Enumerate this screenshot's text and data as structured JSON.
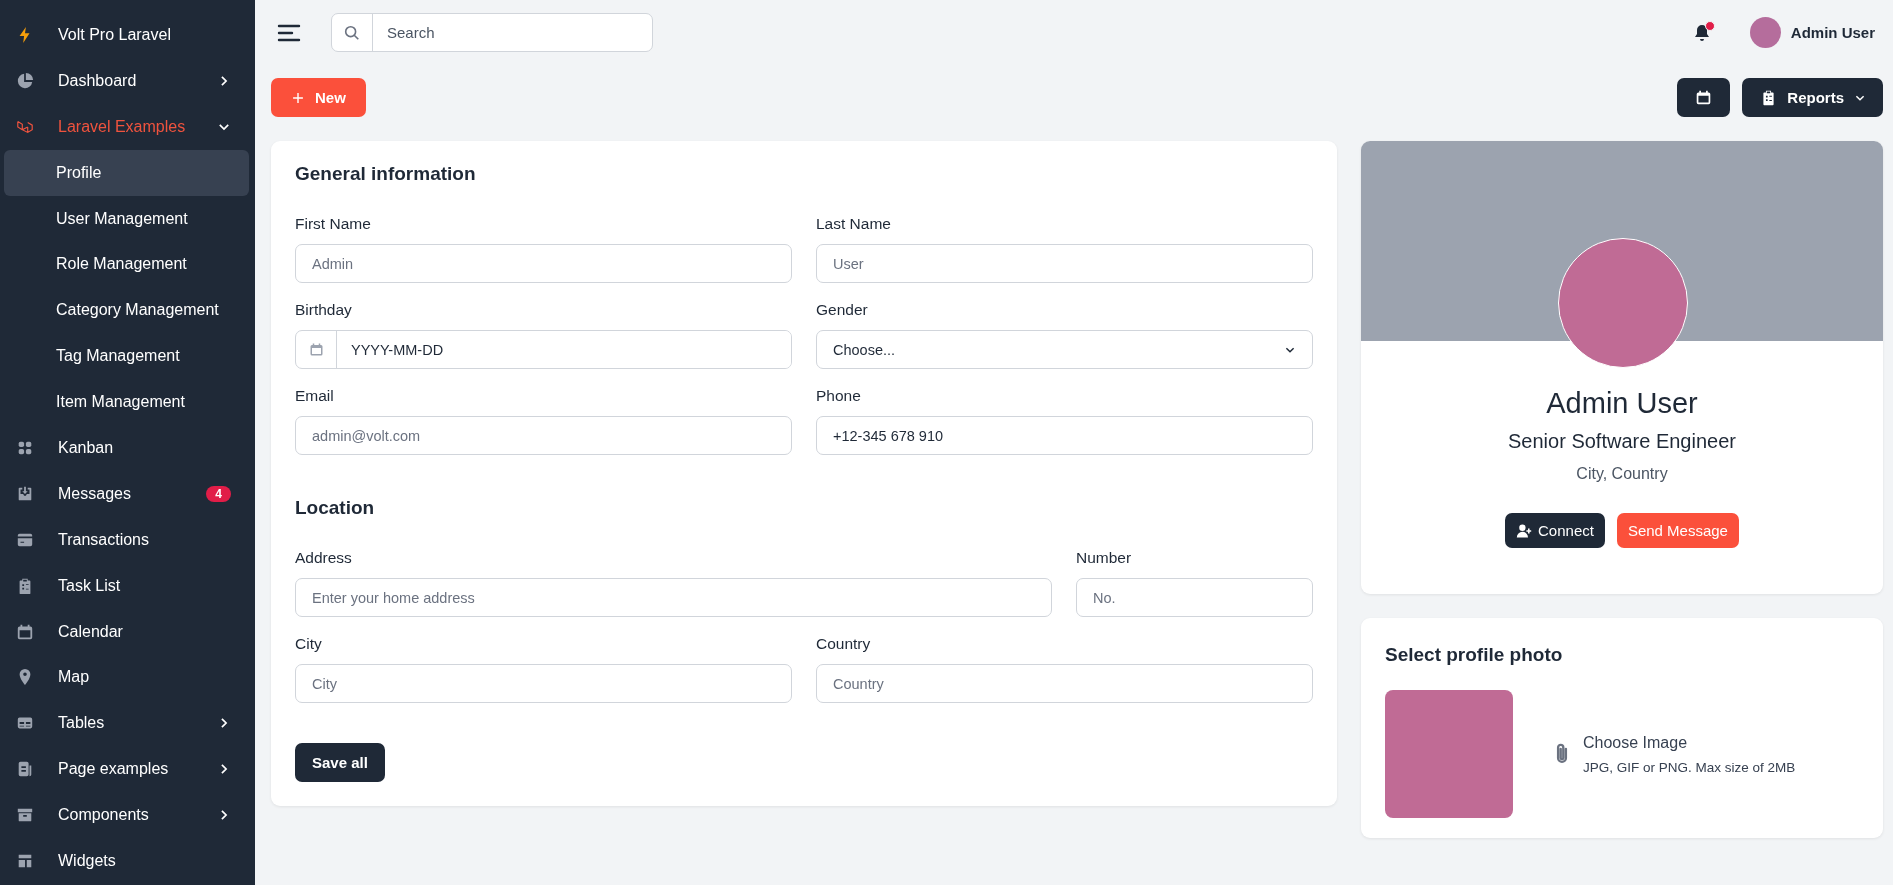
{
  "sidebar": {
    "brand": "Volt Pro Laravel",
    "items": [
      {
        "label": "Dashboard",
        "selected": false,
        "expanded": false
      },
      {
        "label": "Laravel Examples",
        "selected": true,
        "expanded": true,
        "children": [
          {
            "label": "Profile",
            "selected": true
          },
          {
            "label": "User Management",
            "selected": false
          },
          {
            "label": "Role Management",
            "selected": false
          },
          {
            "label": "Category Management",
            "selected": false
          },
          {
            "label": "Tag Management",
            "selected": false
          },
          {
            "label": "Item Management",
            "selected": false
          }
        ]
      },
      {
        "label": "Kanban",
        "selected": false
      },
      {
        "label": "Messages",
        "selected": false,
        "badge": "4"
      },
      {
        "label": "Transactions",
        "selected": false
      },
      {
        "label": "Task List",
        "selected": false
      },
      {
        "label": "Calendar",
        "selected": false
      },
      {
        "label": "Map",
        "selected": false
      },
      {
        "label": "Tables",
        "selected": false,
        "expanded": false
      },
      {
        "label": "Page examples",
        "selected": false,
        "expanded": false
      },
      {
        "label": "Components",
        "selected": false,
        "expanded": false
      },
      {
        "label": "Widgets",
        "selected": false
      }
    ]
  },
  "topbar": {
    "search": {
      "placeholder": "Search"
    },
    "notifications": {
      "unread": true
    },
    "user": {
      "name": "Admin User"
    }
  },
  "actions": {
    "new_button": "New",
    "reports_button": "Reports"
  },
  "general_information": {
    "title": "General information",
    "fields": [
      {
        "label": "First Name",
        "kind": "text",
        "placeholder": "Admin"
      },
      {
        "label": "Last Name",
        "kind": "text",
        "placeholder": "User"
      },
      {
        "label": "Birthday",
        "kind": "date",
        "value": "YYYY-MM-DD"
      },
      {
        "label": "Gender",
        "kind": "select",
        "value": "Choose..."
      },
      {
        "label": "Email",
        "kind": "text",
        "placeholder": "admin@volt.com"
      },
      {
        "label": "Phone",
        "kind": "text",
        "value": "+12-345 678 910"
      }
    ]
  },
  "location": {
    "title": "Location",
    "fields": [
      {
        "label": "Address",
        "kind": "text",
        "placeholder": "Enter your home address"
      },
      {
        "label": "Number",
        "kind": "text",
        "placeholder": "No."
      },
      {
        "label": "City",
        "kind": "text",
        "placeholder": "City"
      },
      {
        "label": "Country",
        "kind": "text",
        "placeholder": "Country"
      }
    ]
  },
  "save_button": "Save all",
  "profile": {
    "name": "Admin User",
    "title": "Senior Software Engineer",
    "location": "City, Country",
    "connect_button": "Connect",
    "message_button": "Send Message"
  },
  "photo_card": {
    "title": "Select profile photo",
    "choose_label": "Choose Image",
    "hint": "JPG, GIF or PNG. Max size of 2MB"
  }
}
